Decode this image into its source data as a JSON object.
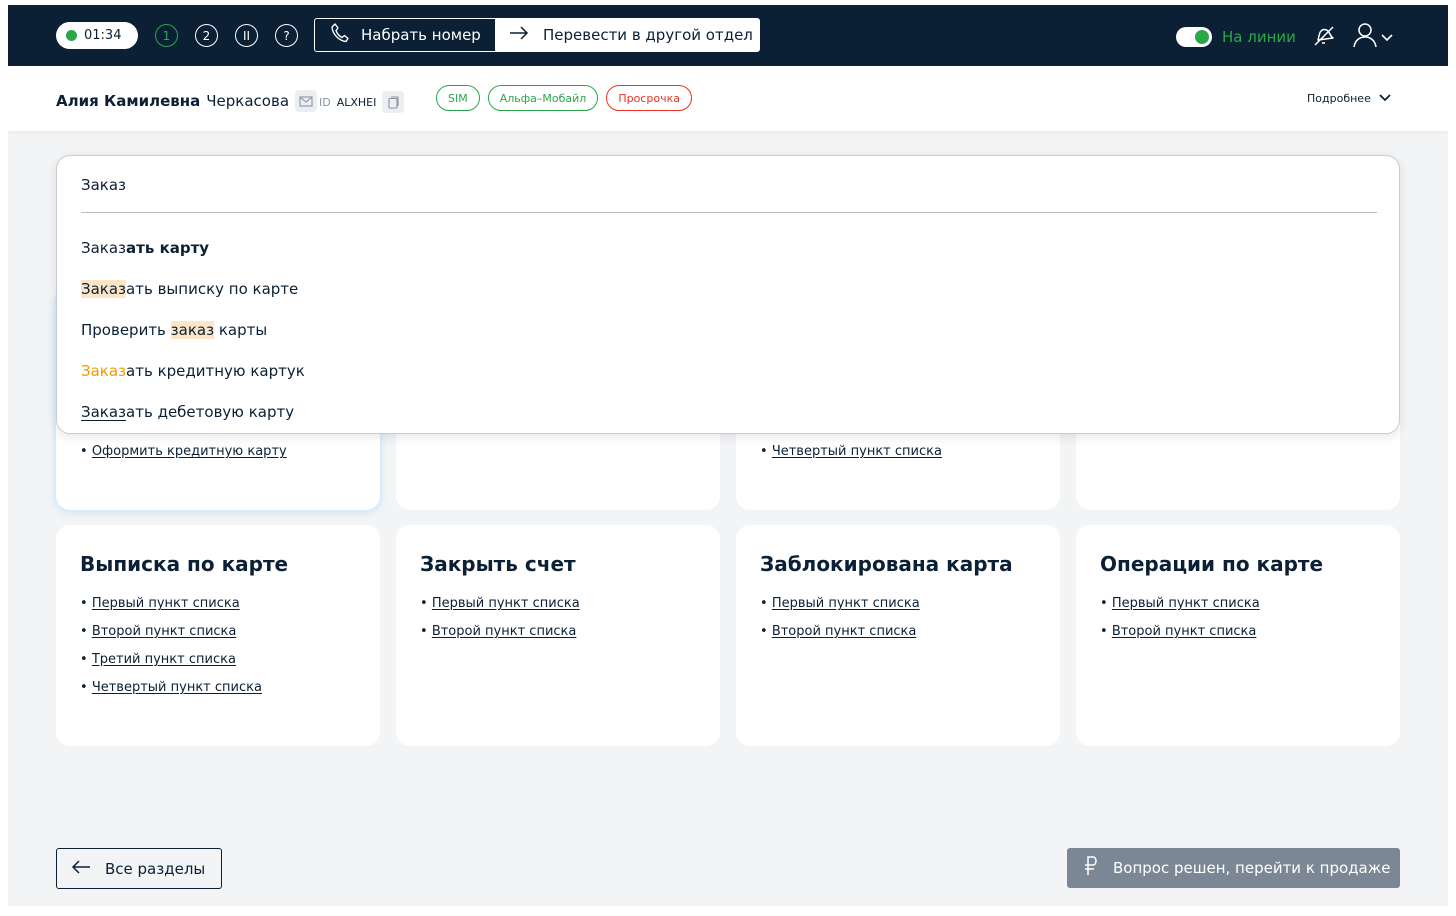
{
  "header": {
    "timer": "01:34",
    "line_buttons": [
      "1",
      "2",
      "II",
      "?"
    ],
    "dial_label": "Набрать номер",
    "transfer_label": "Перевести в другой отдел",
    "status_label": "На линии",
    "status_on": true
  },
  "client": {
    "first_names": "Алия Камилевна",
    "last_name": "Черкасова",
    "id_label": "ID",
    "id_value": "ALXHEI",
    "tags": [
      "SIM",
      "Альфа–Мобайл",
      "Просрочка"
    ],
    "more_label": "Подробнее"
  },
  "search": {
    "value": "Заказ",
    "suggestions": [
      {
        "match": "Заказ",
        "rest": "ать карту"
      },
      {
        "match": "Заказ",
        "rest": "ать выписку по карте"
      },
      {
        "prefix": "Проверить ",
        "match": "заказ",
        "rest": " карты"
      },
      {
        "match": "Заказ",
        "rest": "ать кредитную картук"
      },
      {
        "match": "Заказ",
        "rest": "ать дебетовую карту"
      }
    ]
  },
  "cards_row1": [
    {
      "items": [
        "Оформить кредитную карту"
      ]
    },
    {
      "items": []
    },
    {
      "items": [
        "Четвертый пункт списка"
      ]
    },
    {
      "items": []
    }
  ],
  "cards_row2": [
    {
      "title": "Выписка по карте",
      "items": [
        "Первый пункт списка",
        "Второй пункт списка",
        "Третий пункт списка",
        "Четвертый пункт списка"
      ]
    },
    {
      "title": "Закрыть счет",
      "items": [
        "Первый пункт списка",
        "Второй пункт списка"
      ]
    },
    {
      "title": "Заблокирована карта",
      "items": [
        "Первый пункт списка",
        "Второй пункт списка"
      ]
    },
    {
      "title": "Операции по карте",
      "items": [
        "Первый пункт списка",
        "Второй пункт списка"
      ]
    }
  ],
  "footer": {
    "back_label": "Все разделы",
    "sell_label": "Вопрос решен, перейти к продаже"
  },
  "colors": {
    "header_bg": "#0b1f35",
    "accent_green": "#2ba749",
    "tag_red": "#ef3124",
    "highlight_orange": "#f29a00",
    "highlight_bg": "#fde6c7",
    "disabled_button": "#7b8794"
  },
  "icons": {
    "dial": "phone-icon",
    "transfer": "arrow-right-icon",
    "bell": "bell-off-icon",
    "user": "user-icon",
    "email": "mail-icon",
    "copy": "copy-icon",
    "back": "arrow-left-icon",
    "sell": "ruble-icon"
  }
}
